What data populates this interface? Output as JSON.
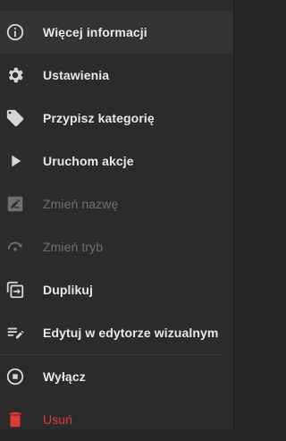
{
  "menu": {
    "items": [
      {
        "label": "Więcej informacji",
        "icon": "info-icon"
      },
      {
        "label": "Ustawienia",
        "icon": "gear-icon"
      },
      {
        "label": "Przypisz kategorię",
        "icon": "tag-icon"
      },
      {
        "label": "Uruchom akcje",
        "icon": "play-icon"
      },
      {
        "label": "Zmień nazwę",
        "icon": "rename-icon",
        "disabled": true
      },
      {
        "label": "Zmień tryb",
        "icon": "mode-icon",
        "disabled": true
      },
      {
        "label": "Duplikuj",
        "icon": "duplicate-icon"
      },
      {
        "label": "Edytuj w edytorze wizualnym",
        "icon": "edit-list-icon"
      },
      {
        "label": "Wyłącz",
        "icon": "stop-icon"
      },
      {
        "label": "Usuń",
        "icon": "trash-icon",
        "danger": true
      }
    ]
  },
  "colors": {
    "background": "#2b2b2b",
    "text": "#e8e8e8",
    "disabled": "#6f6f6f",
    "danger": "#e53935"
  }
}
